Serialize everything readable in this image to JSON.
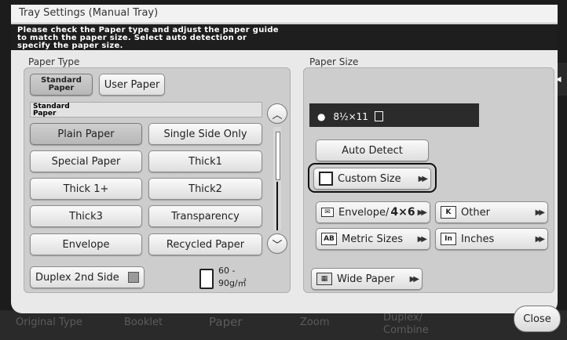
{
  "background_tabs": [
    "Original Type",
    "Booklet",
    "Paper",
    "Zoom",
    "Duplex/",
    "Combine"
  ],
  "dialog": {
    "title": "Tray Settings (Manual Tray)",
    "message_lines": [
      "Please check the Paper type and adjust the paper guide",
      "to match the paper size. Select auto detection or",
      "specify the paper size."
    ]
  },
  "paper_type": {
    "label": "Paper Type",
    "tabs": [
      {
        "line1": "Standard",
        "line2": "Paper",
        "selected": true
      },
      {
        "label": "User Paper",
        "selected": false
      }
    ],
    "section_line1": "Standard",
    "section_line2": "Paper",
    "buttons": [
      {
        "label": "Plain Paper",
        "selected": true
      },
      {
        "label": "Single Side Only",
        "selected": false
      },
      {
        "label": "Special Paper",
        "selected": false
      },
      {
        "label": "Thick1",
        "selected": false
      },
      {
        "label": "Thick 1+",
        "selected": false
      },
      {
        "label": "Thick2",
        "selected": false
      },
      {
        "label": "Thick3",
        "selected": false
      },
      {
        "label": "Transparency",
        "selected": false
      },
      {
        "label": "Envelope",
        "selected": false
      },
      {
        "label": "Recycled Paper",
        "selected": false
      }
    ],
    "duplex_label": "Duplex 2nd Side",
    "weight_line1": "60 -",
    "weight_line2": "90g/㎡"
  },
  "paper_size": {
    "label": "Paper Size",
    "current_size": "8½×11",
    "auto_detect": "Auto Detect",
    "custom_size": "Custom Size",
    "envelope_label": "Envelope/",
    "envelope_size": "4×6",
    "other": "Other",
    "metric_sizes": "Metric Sizes",
    "inches": "Inches",
    "wide_paper": "Wide Paper"
  },
  "close_label": "Close",
  "colors": {
    "dialog_bg": "#e9e9e9",
    "message_bar": "#1e1e1e",
    "panel": "#cdcdcd",
    "selected_outline": "#111111"
  }
}
